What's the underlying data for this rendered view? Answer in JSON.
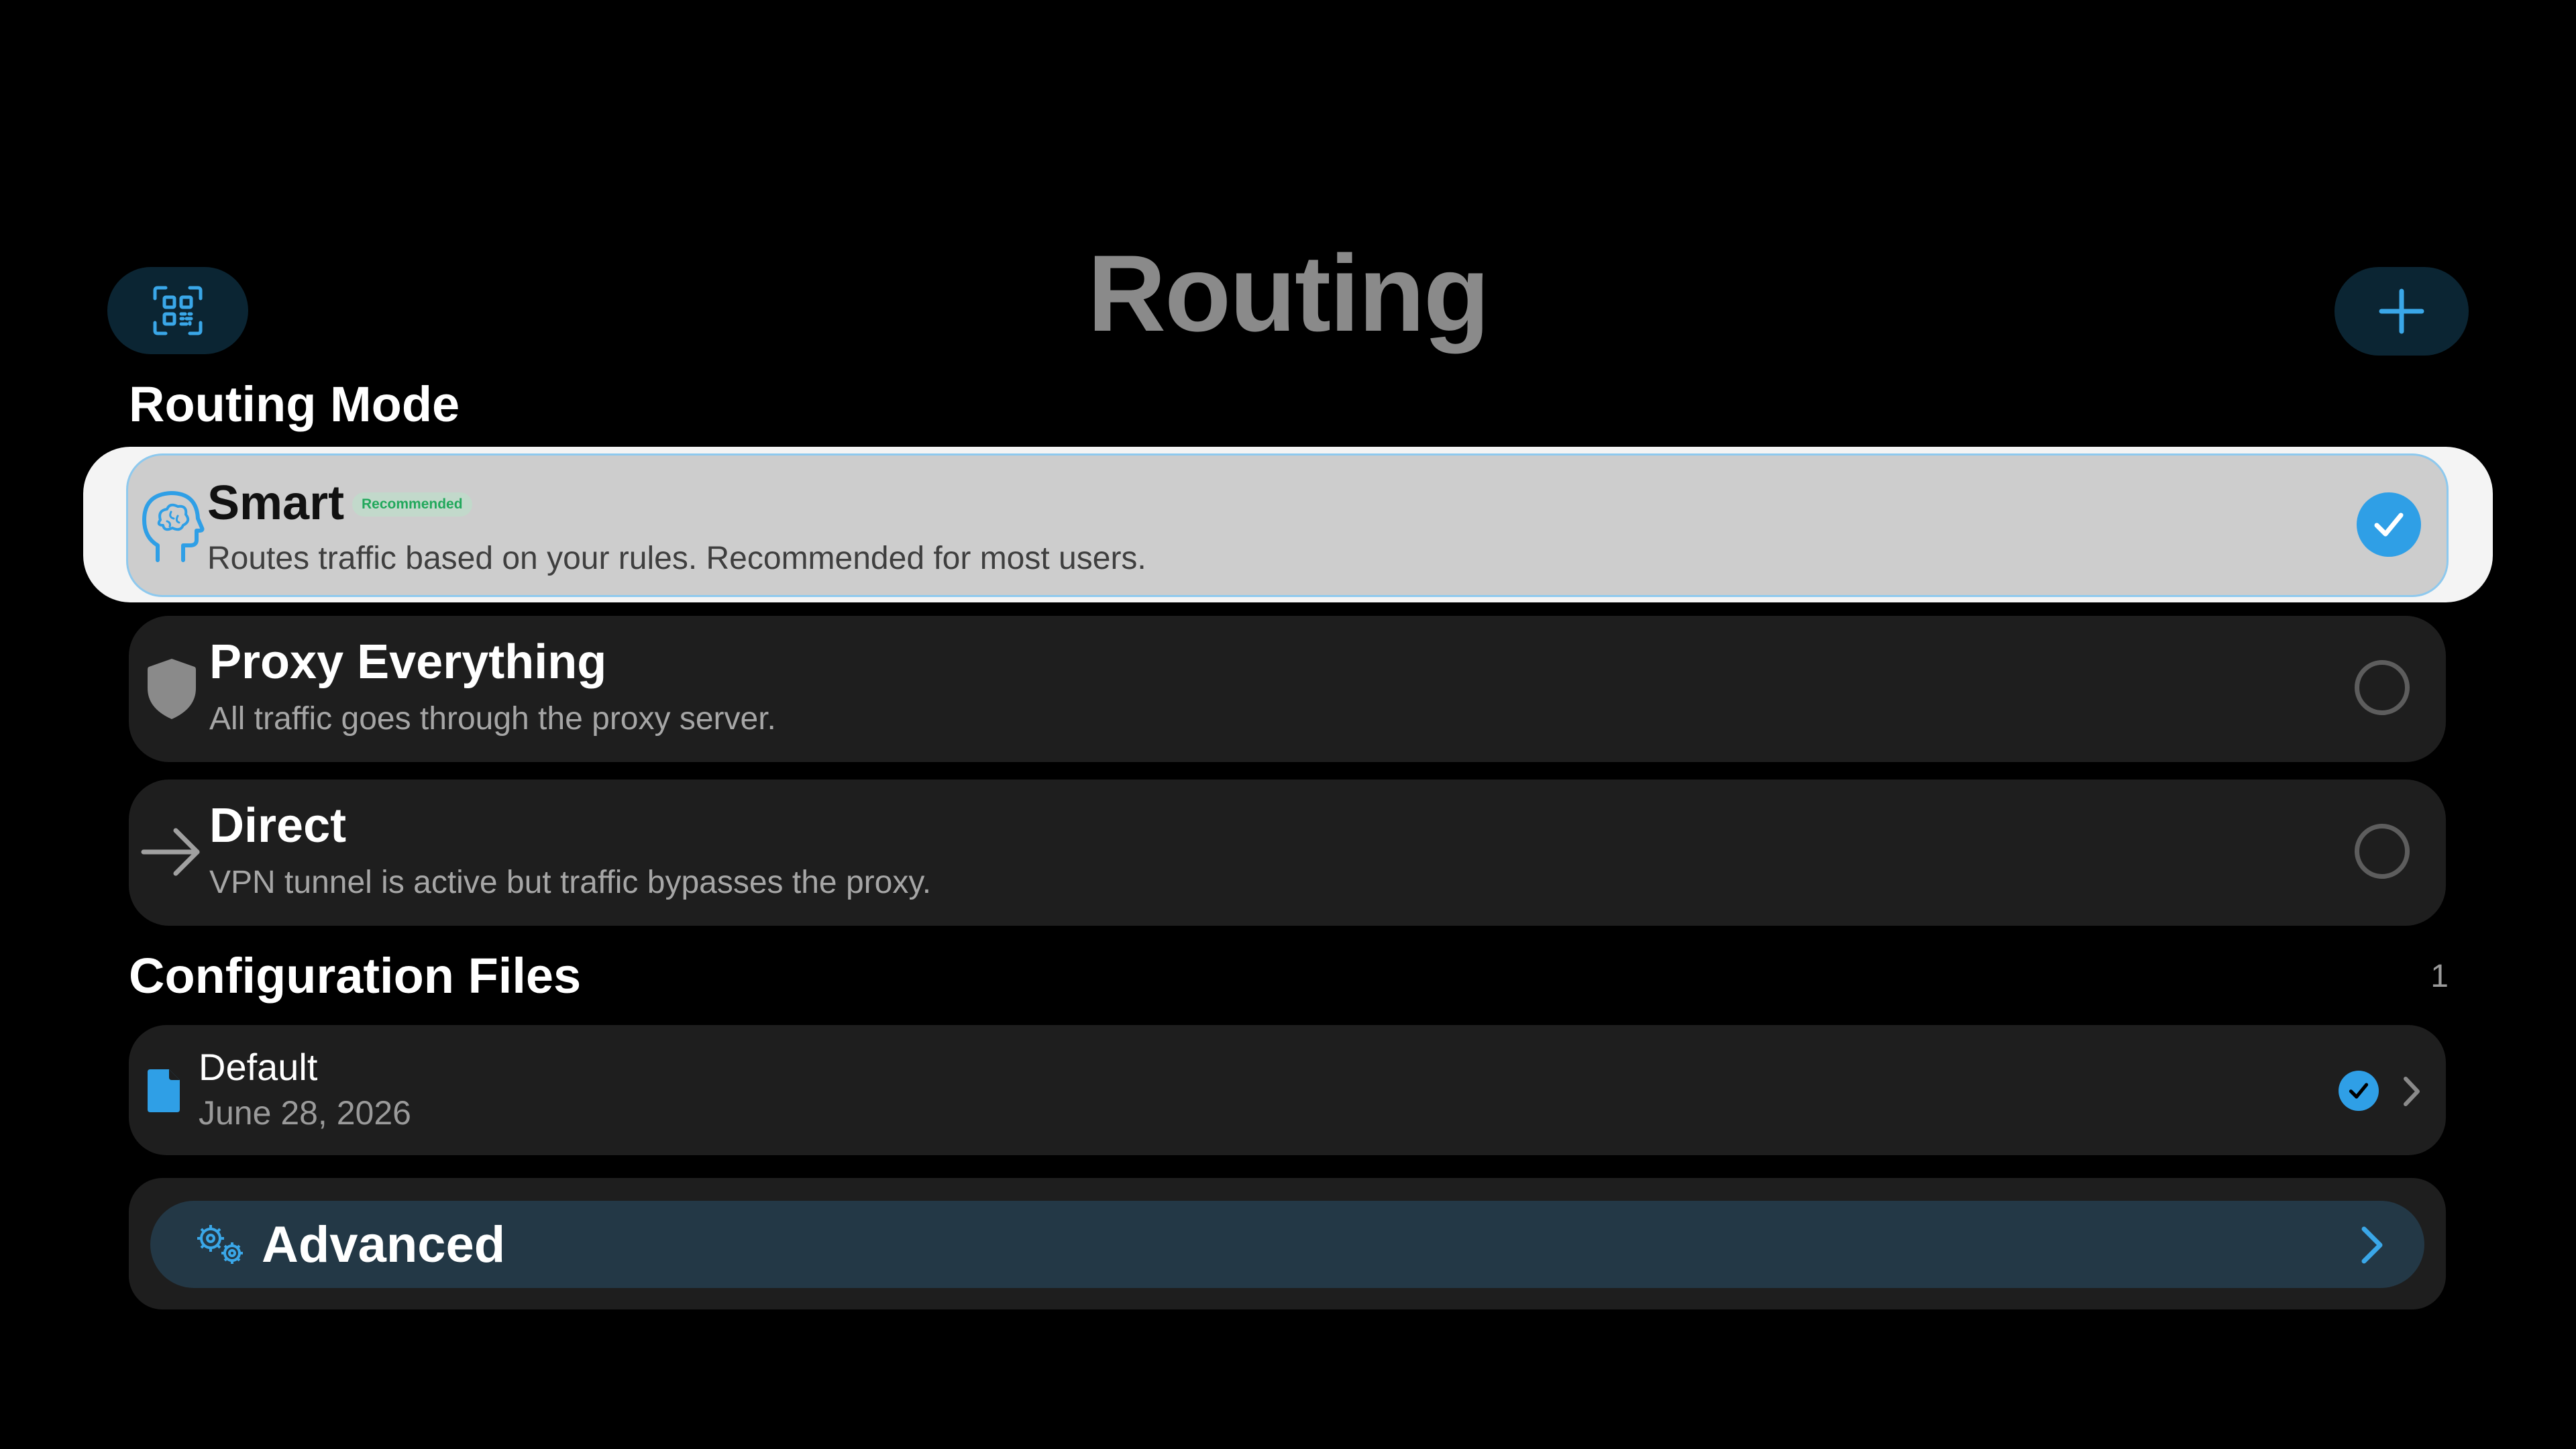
{
  "header": {
    "title": "Routing",
    "scan_icon": "qr-scan-icon",
    "add_icon": "plus-icon"
  },
  "routing_mode": {
    "section_title": "Routing Mode",
    "options": [
      {
        "id": "smart",
        "icon": "brain-head-icon",
        "title": "Smart",
        "badge": "Recommended",
        "subtitle": "Routes traffic based on your rules. Recommended for most users.",
        "selected": true
      },
      {
        "id": "proxy-everything",
        "icon": "shield-icon",
        "title": "Proxy Everything",
        "subtitle": "All traffic goes through the proxy server.",
        "selected": false
      },
      {
        "id": "direct",
        "icon": "arrow-right-icon",
        "title": "Direct",
        "subtitle": "VPN tunnel is active but traffic bypasses the proxy.",
        "selected": false
      }
    ]
  },
  "configuration_files": {
    "section_title": "Configuration Files",
    "count": "1",
    "files": [
      {
        "icon": "document-icon",
        "name": "Default",
        "date": "June 28, 2026",
        "active": true
      }
    ]
  },
  "advanced": {
    "icon": "gears-icon",
    "label": "Advanced"
  },
  "colors": {
    "background": "#000000",
    "accent": "#2f9fe6",
    "card": "#1e1e1e",
    "selected_card": "#cdcdcd",
    "header_button": "#0b2533",
    "advanced_button": "#233846",
    "badge_text": "#22a85c"
  }
}
